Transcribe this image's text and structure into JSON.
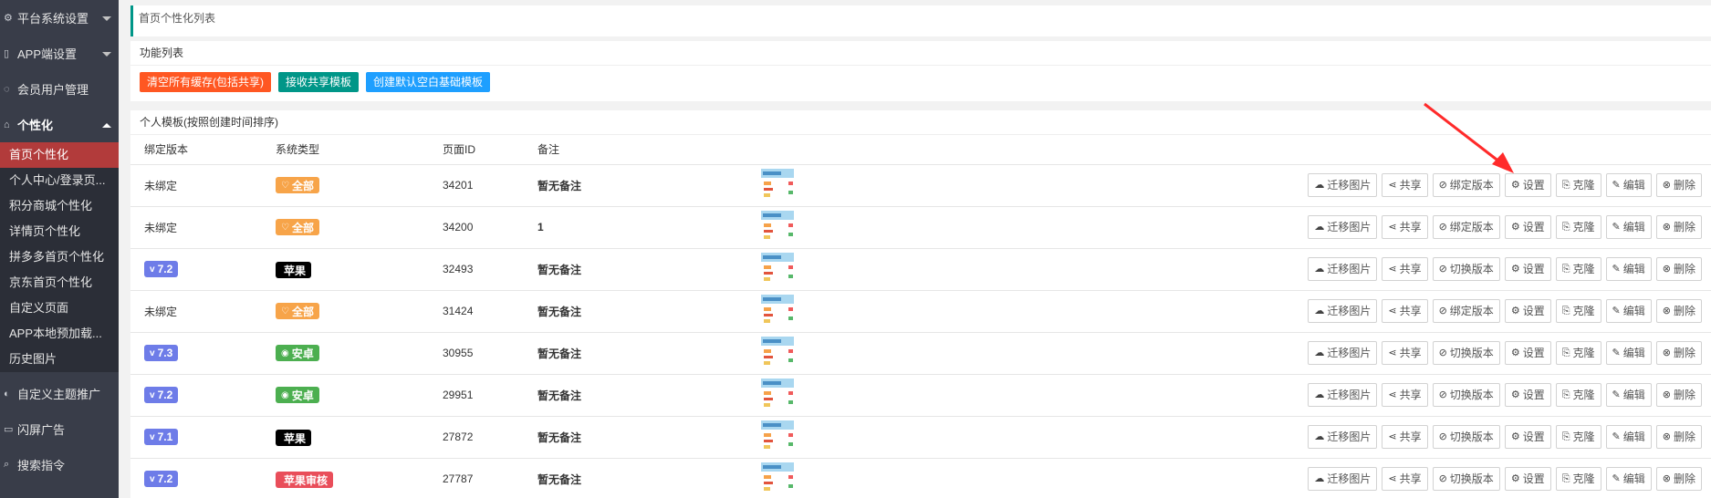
{
  "sidebar": {
    "groups_top": [
      {
        "label": "平台系统设置",
        "icon": "gear-icon"
      },
      {
        "label": "APP端设置",
        "icon": "phone-icon"
      },
      {
        "label": "会员用户管理",
        "icon": "user-icon"
      }
    ],
    "open_group": {
      "label": "个性化",
      "icon": "palette-icon"
    },
    "sub_items": [
      "首页个性化",
      "个人中心/登录页...",
      "积分商城个性化",
      "详情页个性化",
      "拼多多首页个性化",
      "京东首页个性化",
      "自定义页面",
      "APP本地预加载...",
      "历史图片"
    ],
    "active_sub": 0,
    "groups_bottom": [
      {
        "label": "自定义主题推广",
        "icon": "theme-icon"
      },
      {
        "label": "闪屏广告",
        "icon": "splash-icon"
      },
      {
        "label": "搜索指令",
        "icon": "search-icon"
      }
    ]
  },
  "page_title": "首页个性化列表",
  "func_panel": {
    "title": "功能列表",
    "buttons": [
      {
        "label": "清空所有缓存(包括共享)",
        "color": "#ff5722"
      },
      {
        "label": "接收共享模板",
        "color": "#009688"
      },
      {
        "label": "创建默认空白基础模板",
        "color": "#1e9fff"
      }
    ]
  },
  "template_panel": {
    "title": "个人模板(按照创建时间排序)",
    "columns": [
      "绑定版本",
      "系统类型",
      "页面ID",
      "备注"
    ],
    "rows": [
      {
        "version": "未绑定",
        "version_badge": false,
        "system": "全部",
        "system_type": "all",
        "page_id": "34201",
        "note": "暂无备注",
        "bind_label": "绑定版本"
      },
      {
        "version": "未绑定",
        "version_badge": false,
        "system": "全部",
        "system_type": "all",
        "page_id": "34200",
        "note": "1",
        "bind_label": "绑定版本"
      },
      {
        "version": "7.2",
        "version_badge": true,
        "system": "苹果",
        "system_type": "apple",
        "page_id": "32493",
        "note": "暂无备注",
        "bind_label": "切换版本"
      },
      {
        "version": "未绑定",
        "version_badge": false,
        "system": "全部",
        "system_type": "all",
        "page_id": "31424",
        "note": "暂无备注",
        "bind_label": "绑定版本"
      },
      {
        "version": "7.3",
        "version_badge": true,
        "system": "安卓",
        "system_type": "android",
        "page_id": "30955",
        "note": "暂无备注",
        "bind_label": "切换版本"
      },
      {
        "version": "7.2",
        "version_badge": true,
        "system": "安卓",
        "system_type": "android",
        "page_id": "29951",
        "note": "暂无备注",
        "bind_label": "切换版本"
      },
      {
        "version": "7.1",
        "version_badge": true,
        "system": "苹果",
        "system_type": "apple",
        "page_id": "27872",
        "note": "暂无备注",
        "bind_label": "切换版本"
      },
      {
        "version": "7.2",
        "version_badge": true,
        "system": "苹果审核",
        "system_type": "review",
        "page_id": "27787",
        "note": "暂无备注",
        "bind_label": "切换版本"
      }
    ],
    "row_actions": {
      "migrate": "迁移图片",
      "share": "共享",
      "settings": "设置",
      "clone": "克隆",
      "edit": "编辑",
      "delete": "删除"
    }
  },
  "colors": {
    "sidebar_bg": "#393d49",
    "active_item": "#b23b3b",
    "accent": "#009688",
    "annotation_arrow": "#ff2a2a"
  }
}
